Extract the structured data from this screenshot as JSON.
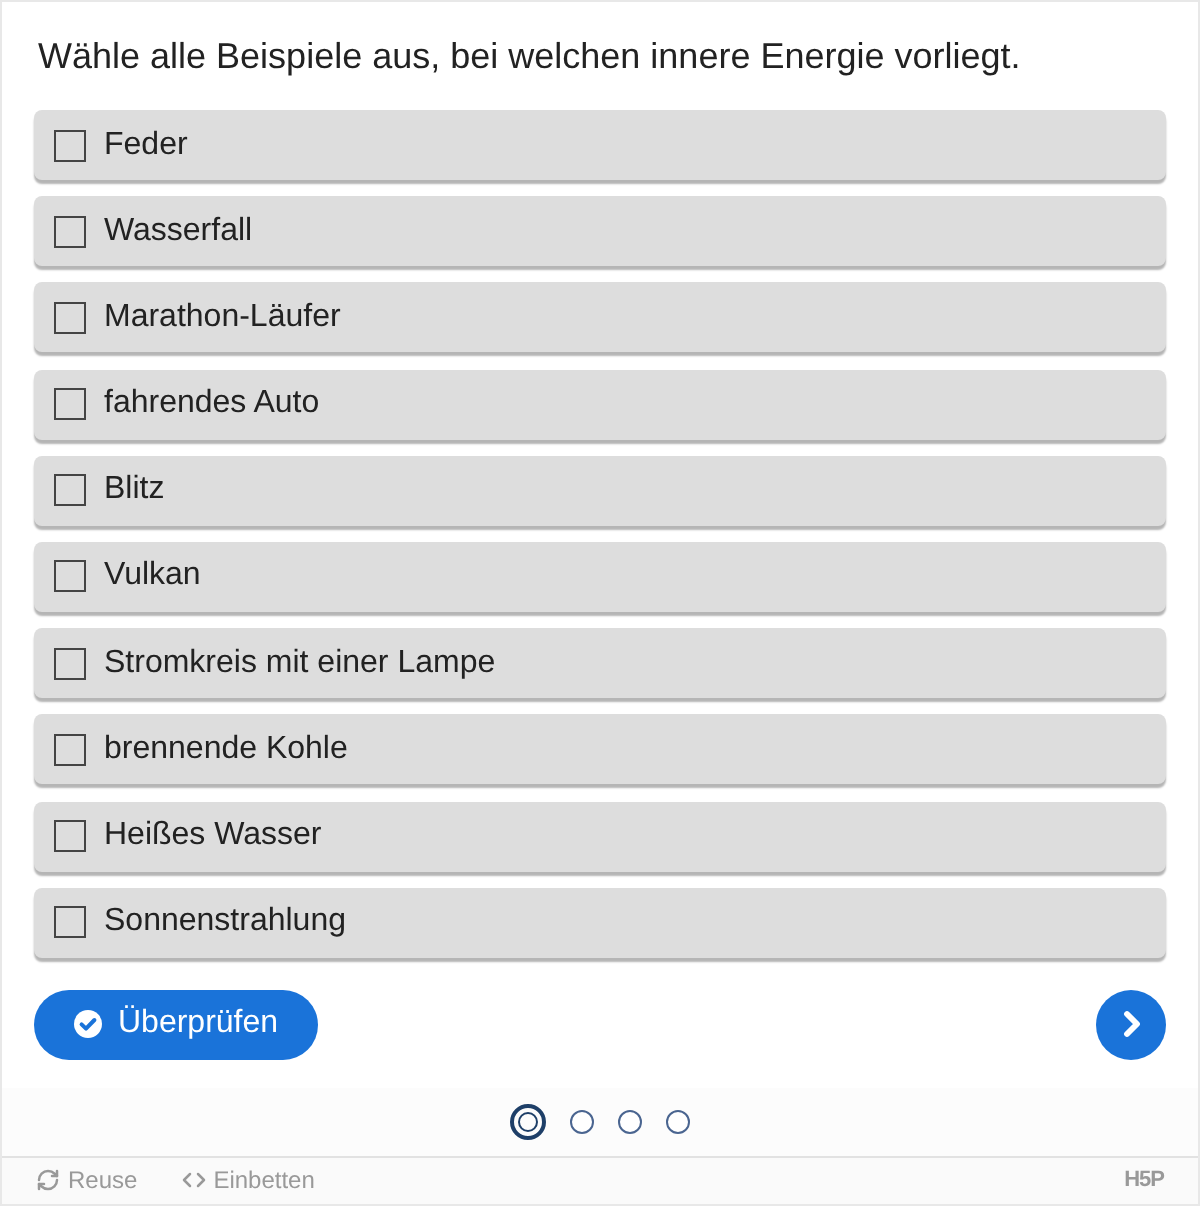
{
  "question": "Wähle alle Beispiele aus, bei welchen innere Energie vorliegt.",
  "options": [
    {
      "label": "Feder",
      "checked": false
    },
    {
      "label": "Wasserfall",
      "checked": false
    },
    {
      "label": "Marathon-Läufer",
      "checked": false
    },
    {
      "label": "fahrendes Auto",
      "checked": false
    },
    {
      "label": "Blitz",
      "checked": false
    },
    {
      "label": "Vulkan",
      "checked": false
    },
    {
      "label": "Stromkreis mit einer Lampe",
      "checked": false
    },
    {
      "label": "brennende Kohle",
      "checked": false
    },
    {
      "label": "Heißes Wasser",
      "checked": false
    },
    {
      "label": "Sonnenstrahlung",
      "checked": false
    }
  ],
  "check_button": {
    "label": "Überprüfen"
  },
  "slides": [
    {
      "selected": true
    },
    {
      "selected": false
    },
    {
      "selected": false
    },
    {
      "selected": false
    }
  ],
  "footer": {
    "links": [
      {
        "kind": "reuse",
        "label": "Reuse"
      },
      {
        "kind": "embed",
        "label": "Einbetten"
      }
    ],
    "logo": "H5P"
  }
}
